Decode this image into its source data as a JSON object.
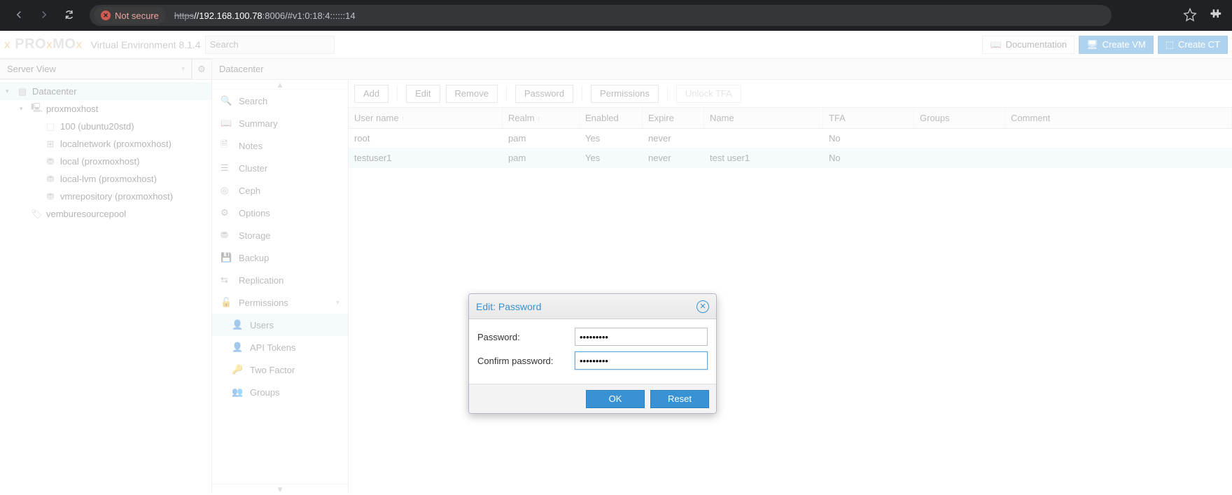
{
  "browser": {
    "not_secure": "Not secure",
    "url_proto": "https",
    "url_rest": "://192.168.100.78:8006/#v1:0:18:4::::::14",
    "url_host_display": "//192.168.100.78"
  },
  "header": {
    "brand": "Virtual Environment 8.1.4",
    "search_placeholder": "Search",
    "documentation": "Documentation",
    "create_vm": "Create VM",
    "create_ct": "Create CT"
  },
  "server_view_label": "Server View",
  "tree": {
    "datacenter": "Datacenter",
    "host": "proxmoxhost",
    "vm": "100 (ubuntu20std)",
    "net": "localnetwork (proxmoxhost)",
    "local": "local (proxmoxhost)",
    "lvm": "local-lvm (proxmoxhost)",
    "vmrepo": "vmrepository (proxmoxhost)",
    "pool": "vemburesourcepool"
  },
  "crumb": "Datacenter",
  "midnav": {
    "search": "Search",
    "summary": "Summary",
    "notes": "Notes",
    "cluster": "Cluster",
    "ceph": "Ceph",
    "options": "Options",
    "storage": "Storage",
    "backup": "Backup",
    "replication": "Replication",
    "permissions": "Permissions",
    "users": "Users",
    "api_tokens": "API Tokens",
    "two_factor": "Two Factor",
    "groups": "Groups"
  },
  "toolbar": {
    "add": "Add",
    "edit": "Edit",
    "remove": "Remove",
    "password": "Password",
    "permissions": "Permissions",
    "unlock_tfa": "Unlock TFA"
  },
  "columns": {
    "user": "User name",
    "realm": "Realm",
    "enabled": "Enabled",
    "expire": "Expire",
    "name": "Name",
    "tfa": "TFA",
    "groups": "Groups",
    "comment": "Comment"
  },
  "rows": [
    {
      "user": "root",
      "realm": "pam",
      "enabled": "Yes",
      "expire": "never",
      "name": "",
      "tfa": "No",
      "groups": "",
      "comment": ""
    },
    {
      "user": "testuser1",
      "realm": "pam",
      "enabled": "Yes",
      "expire": "never",
      "name": "test user1",
      "tfa": "No",
      "groups": "",
      "comment": ""
    }
  ],
  "modal": {
    "title": "Edit: Password",
    "password_label": "Password:",
    "confirm_label": "Confirm password:",
    "password_value": "•••••••••",
    "confirm_value": "•••••••••",
    "ok": "OK",
    "reset": "Reset"
  }
}
